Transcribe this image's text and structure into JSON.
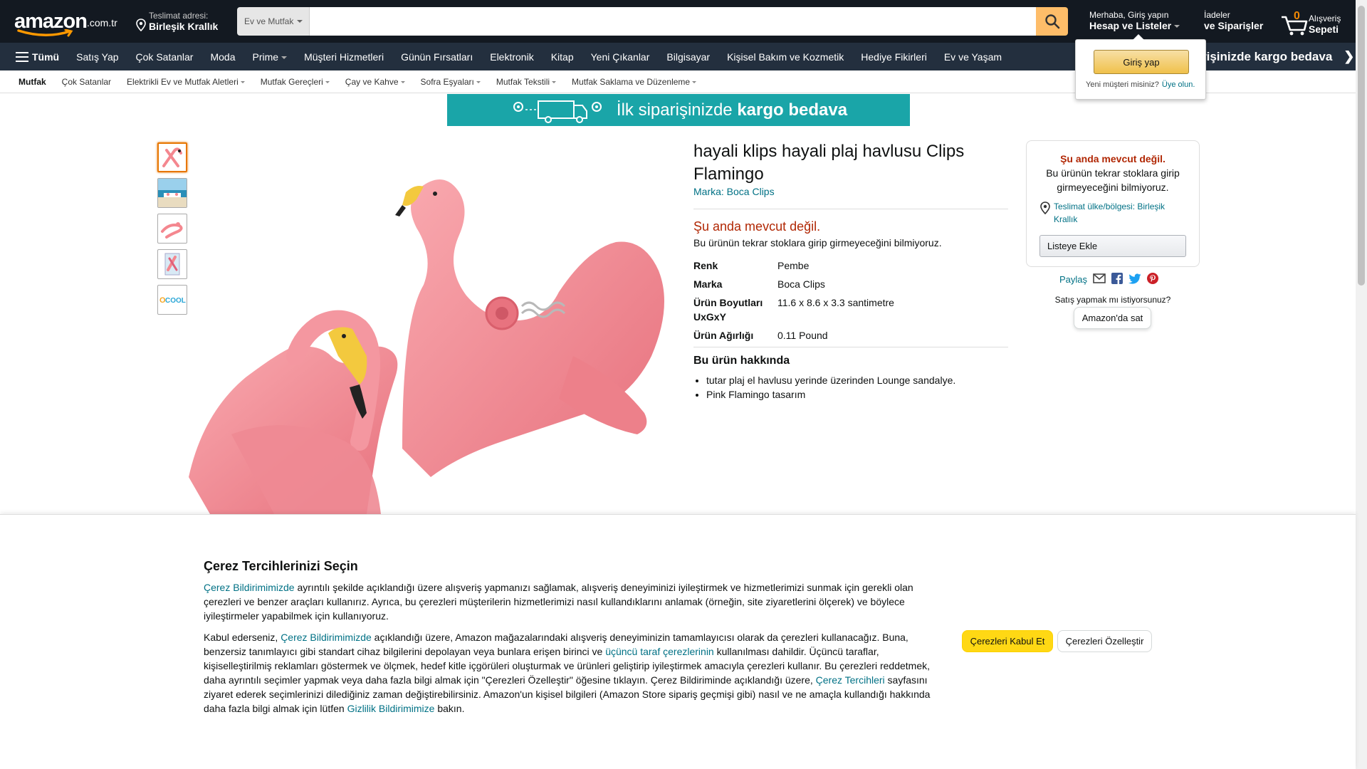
{
  "header": {
    "logo_text": "amazon",
    "logo_tld": ".com.tr",
    "deliver_line1": "Teslimat adresi:",
    "deliver_line2": "Birleşik Krallık",
    "search_category": "Ev ve Mutfak",
    "search_placeholder": "",
    "account_line1": "Merhaba, Giriş yapın",
    "account_line2": "Hesap ve Listeler",
    "orders_line1": "İadeler",
    "orders_line2": "ve Siparişler",
    "cart_count": "0",
    "cart_line1": "Alışveriş",
    "cart_line2": "Sepeti"
  },
  "nav": {
    "all_label": "Tümü",
    "items": [
      "Satış Yap",
      "Çok Satanlar",
      "Moda",
      "Prime",
      "Müşteri Hizmetleri",
      "Günün Fırsatları",
      "Elektronik",
      "Kitap",
      "Yeni Çıkanlar",
      "Bilgisayar",
      "Kişisel Bakım ve Kozmetik",
      "Hediye Fikirleri",
      "Ev ve Yaşam"
    ],
    "promo": "rişinizde kargo bedava"
  },
  "subnav": {
    "first": "Mutfak",
    "items": [
      "Çok Satanlar",
      "Elektrikli Ev ve Mutfak Aletleri",
      "Mutfak Gereçleri",
      "Çay ve Kahve",
      "Sofra Eşyaları",
      "Mutfak Tekstili",
      "Mutfak Saklama ve Düzenleme"
    ]
  },
  "flyout": {
    "signin": "Giriş yap",
    "new_customer": "Yeni müşteri misiniz?",
    "register": "Üye olun."
  },
  "banner": {
    "prefix": "İlk siparişinizde",
    "emph": "kargo bedava"
  },
  "product": {
    "title": "hayali klips hayali plaj havlusu Clips Flamingo",
    "brand": "Marka: Boca Clips",
    "unavailable": "Şu anda mevcut değil.",
    "unavailable_sub": "Bu ürünün tekrar stoklara girip girmeyeceğini bilmiyoruz.",
    "specs": [
      {
        "k": "Renk",
        "v": "Pembe"
      },
      {
        "k": "Marka",
        "v": "Boca Clips"
      },
      {
        "k": "Ürün Boyutları UxGxY",
        "v": "11.6 x 8.6 x 3.3 santimetre"
      },
      {
        "k": "Ürün Ağırlığı",
        "v": "0.11 Pound"
      }
    ],
    "about_heading": "Bu ürün hakkında",
    "bullets": [
      "tutar plaj el havlusu yerinde üzerinden Lounge sandalye.",
      "Pink Flamingo tasarım"
    ]
  },
  "buybox": {
    "unavailable": "Şu anda mevcut değil.",
    "sub": "Bu ürünün tekrar stoklara girip girmeyeceğini bilmiyoruz.",
    "deliver": "Teslimat ülke/bölgesi: Birleşik Krallık",
    "add_to_list": "Listeye Ekle",
    "share": "Paylaş",
    "sell_question": "Satış yapmak mı istiyorsunuz?",
    "sell_button": "Amazon'da sat"
  },
  "cookie": {
    "title": "Çerez Tercihlerinizi Seçin",
    "p1_link": "Çerez Bildirimimizde",
    "p1_text": " ayrıntılı şekilde açıklandığı üzere alışveriş yapmanızı sağlamak, alışveriş deneyiminizi iyileştirmek ve hizmetlerimizi sunmak için gerekli olan çerezleri ve benzer araçları kullanırız. Ayrıca, bu çerezleri müşterilerin hizmetlerimizi nasıl kullandıklarını anlamak (örneğin, site ziyaretlerini ölçerek) ve böylece iyileştirmeler yapabilmek için kullanıyoruz.",
    "p2_a": "Kabul ederseniz, ",
    "p2_link1": "Çerez Bildirimimizde",
    "p2_b": " açıklandığı üzere, Amazon mağazalarındaki alışveriş deneyiminizin tamamlayıcısı olarak da çerezleri kullanacağız. Buna, benzersiz tanımlayıcı gibi standart cihaz bilgilerini depolayan veya bunlara erişen birinci ve ",
    "p2_link2": "üçüncü taraf çerezlerinin",
    "p2_c": " kullanılması dahildir. Üçüncü taraflar, kişiselleştirilmiş reklamları göstermek ve ölçmek, hedef kitle içgörüleri oluşturmak ve ürünleri geliştirip iyileştirmek amacıyla çerezleri kullanır. Bu çerezleri reddetmek, daha ayrıntılı seçimler yapmak veya daha fazla bilgi almak için \"Çerezleri Özelleştir\" öğesine tıklayın. Çerez Bildiriminde açıklandığı üzere, ",
    "p2_link3": "Çerez Tercihleri",
    "p2_d": " sayfasını ziyaret ederek seçimlerinizi dilediğiniz zaman değiştirebilirsiniz. Amazon'un kişisel bilgileri (Amazon Store sipariş geçmişi gibi) nasıl ve ne amaçla kullandığı hakkında daha fazla bilgi almak için lütfen ",
    "p2_link4": "Gizlilik Bildirimimize",
    "p2_e": " bakın.",
    "accept": "Çerezleri Kabul Et",
    "customize": "Çerezleri Özelleştir"
  },
  "colors": {
    "nav_dark": "#131921",
    "nav_sub": "#232f3e",
    "search_button": "#febd69",
    "link": "#007185",
    "unavailable": "#b12704",
    "accept_button": "#ffd814",
    "banner": "#1aa5a8",
    "flamingo": "#f4878f"
  },
  "icons": [
    "location-pin-icon",
    "search-icon",
    "cart-icon",
    "hamburger-icon",
    "email-icon",
    "facebook-icon",
    "twitter-icon",
    "pinterest-icon"
  ]
}
